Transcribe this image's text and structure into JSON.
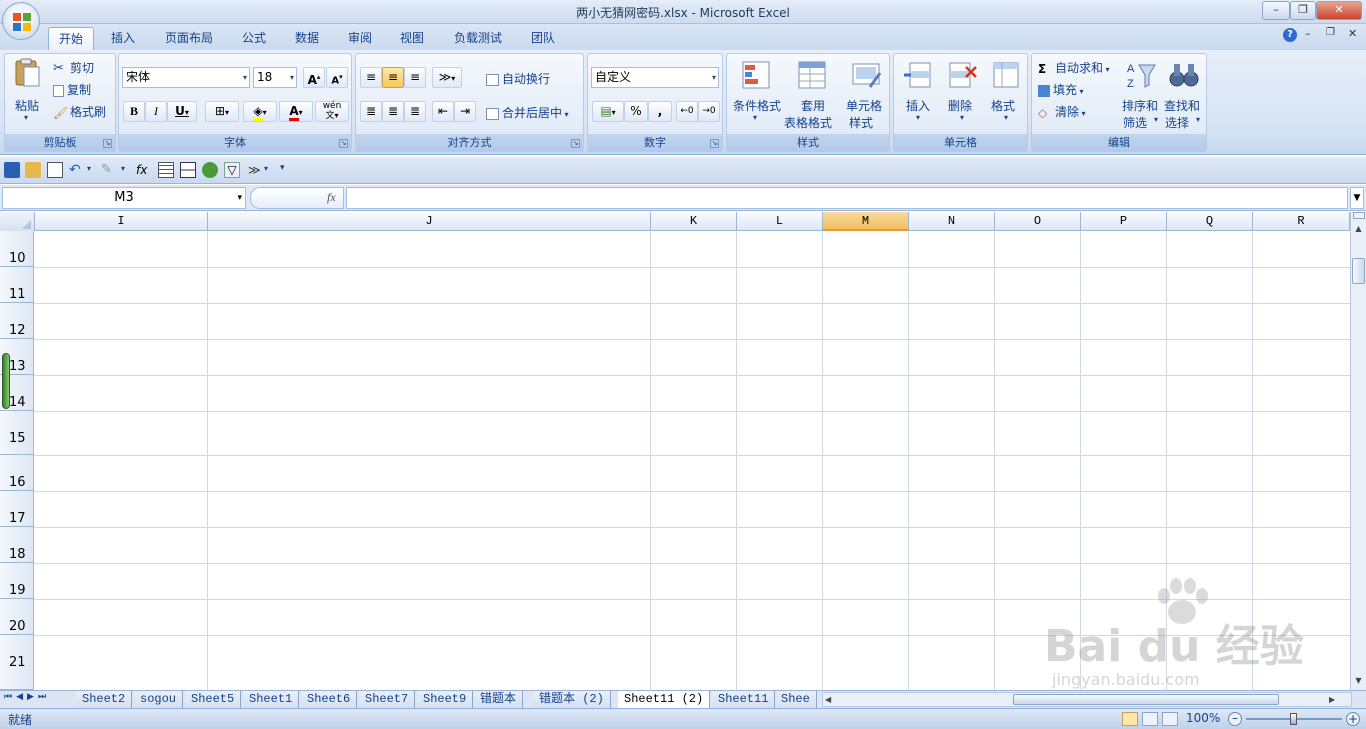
{
  "window": {
    "title": "两小无猜网密码.xlsx - Microsoft Excel",
    "min": "–",
    "restore": "❐",
    "close": "✕"
  },
  "tabs": [
    "开始",
    "插入",
    "页面布局",
    "公式",
    "数据",
    "审阅",
    "视图",
    "负载测试",
    "团队"
  ],
  "active_tab": "开始",
  "ribbon": {
    "clipboard": {
      "label": "剪贴板",
      "paste": "粘贴",
      "cut": "剪切",
      "copy": "复制",
      "format_painter": "格式刷"
    },
    "font": {
      "label": "字体",
      "font_name": "宋体",
      "font_size": "18",
      "bold": "B",
      "italic": "I",
      "underline": "U",
      "grow": "A",
      "shrink": "A",
      "wen": "wén\n文"
    },
    "alignment": {
      "label": "对齐方式",
      "wrap": "自动换行",
      "merge": "合并后居中"
    },
    "number": {
      "label": "数字",
      "format": "自定义",
      "percent": "%",
      "comma": ","
    },
    "styles": {
      "label": "样式",
      "cond": "条件格式",
      "table1": "套用",
      "table2": "表格格式",
      "cell1": "单元格",
      "cell2": "样式"
    },
    "cells": {
      "label": "单元格",
      "insert": "插入",
      "delete": "删除",
      "format": "格式"
    },
    "editing": {
      "label": "编辑",
      "autosum": "自动求和",
      "fill": "填充",
      "clear": "清除",
      "sort1": "排序和",
      "sort2": "筛选",
      "find1": "查找和",
      "find2": "选择"
    }
  },
  "formula_bar": {
    "name_box": "M3",
    "fx": "fx",
    "content": ""
  },
  "columns": [
    {
      "name": "I"
    },
    {
      "name": "J"
    },
    {
      "name": "K"
    },
    {
      "name": "L"
    },
    {
      "name": "M",
      "selected": true
    },
    {
      "name": "N"
    },
    {
      "name": "O"
    },
    {
      "name": "P"
    },
    {
      "name": "Q"
    },
    {
      "name": "R"
    }
  ],
  "rows": [
    "10",
    "11",
    "12",
    "13",
    "14",
    "15",
    "16",
    "17",
    "18",
    "19",
    "20",
    "21"
  ],
  "sheets": [
    "Sheet2",
    "sogou",
    "Sheet5",
    "Sheet1",
    "Sheet6",
    "Sheet7",
    "Sheet9",
    "错题本",
    "错题本 (2)",
    "Sheet11 (2)",
    "Sheet11",
    "Shee"
  ],
  "active_sheet": "Sheet11 (2)",
  "status": {
    "ready": "就绪",
    "zoom": "100%"
  },
  "watermark": {
    "brand": "Bai du 经验",
    "url": "jingyan.baidu.com"
  },
  "colors": {
    "accent": "#15428b",
    "selected_col": "#f1c15f",
    "grid": "#d0d7e5"
  }
}
